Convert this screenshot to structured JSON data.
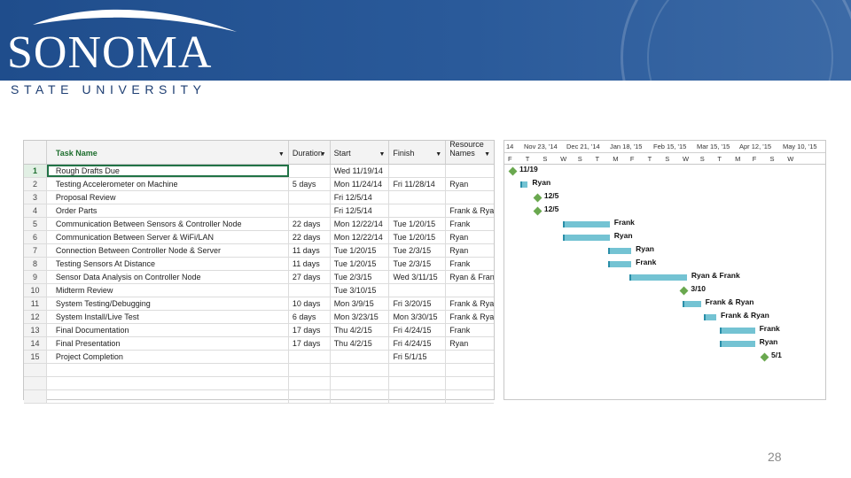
{
  "brand": {
    "name": "SONOMA",
    "subtitle": "STATE UNIVERSITY"
  },
  "page_number": "28",
  "table": {
    "headers": {
      "name": "Task Name",
      "duration": "Duration",
      "start": "Start",
      "finish": "Finish",
      "resources": "Resource Names"
    },
    "rows": [
      {
        "id": "1",
        "name": "Rough Drafts Due",
        "duration": "",
        "start": "Wed 11/19/14",
        "finish": "",
        "resources": ""
      },
      {
        "id": "2",
        "name": "Testing Accelerometer on Machine",
        "duration": "5 days",
        "start": "Mon 11/24/14",
        "finish": "Fri 11/28/14",
        "resources": "Ryan"
      },
      {
        "id": "3",
        "name": "Proposal Review",
        "duration": "",
        "start": "Fri 12/5/14",
        "finish": "",
        "resources": ""
      },
      {
        "id": "4",
        "name": "Order Parts",
        "duration": "",
        "start": "Fri 12/5/14",
        "finish": "",
        "resources": "Frank & Ryan"
      },
      {
        "id": "5",
        "name": "Communication Between Sensors & Controller Node",
        "duration": "22 days",
        "start": "Mon 12/22/14",
        "finish": "Tue 1/20/15",
        "resources": "Frank"
      },
      {
        "id": "6",
        "name": "Communication Between Server & WiFi/LAN",
        "duration": "22 days",
        "start": "Mon 12/22/14",
        "finish": "Tue 1/20/15",
        "resources": "Ryan"
      },
      {
        "id": "7",
        "name": "Connection Between Controller Node & Server",
        "duration": "11 days",
        "start": "Tue 1/20/15",
        "finish": "Tue 2/3/15",
        "resources": "Ryan"
      },
      {
        "id": "8",
        "name": "Testing Sensors At Distance",
        "duration": "11 days",
        "start": "Tue 1/20/15",
        "finish": "Tue 2/3/15",
        "resources": "Frank"
      },
      {
        "id": "9",
        "name": "Sensor Data Analysis on Controller Node",
        "duration": "27 days",
        "start": "Tue 2/3/15",
        "finish": "Wed 3/11/15",
        "resources": "Ryan & Frank"
      },
      {
        "id": "10",
        "name": "Midterm Review",
        "duration": "",
        "start": "Tue 3/10/15",
        "finish": "",
        "resources": ""
      },
      {
        "id": "11",
        "name": "System Testing/Debugging",
        "duration": "10 days",
        "start": "Mon 3/9/15",
        "finish": "Fri 3/20/15",
        "resources": "Frank & Ryan"
      },
      {
        "id": "12",
        "name": "System Install/Live Test",
        "duration": "6 days",
        "start": "Mon 3/23/15",
        "finish": "Mon 3/30/15",
        "resources": "Frank & Ryan"
      },
      {
        "id": "13",
        "name": "Final Documentation",
        "duration": "17 days",
        "start": "Thu 4/2/15",
        "finish": "Fri 4/24/15",
        "resources": "Frank"
      },
      {
        "id": "14",
        "name": "Final Presentation",
        "duration": "17 days",
        "start": "Thu 4/2/15",
        "finish": "Fri 4/24/15",
        "resources": "Ryan"
      },
      {
        "id": "15",
        "name": "Project Completion",
        "duration": "",
        "start": "",
        "finish": "Fri 5/1/15",
        "resources": ""
      }
    ]
  },
  "gantt": {
    "weeks": [
      "14",
      "Nov 23, '14",
      "Dec 21, '14",
      "Jan 18, '15",
      "Feb 15, '15",
      "Mar 15, '15",
      "Apr 12, '15",
      "May 10, '15"
    ],
    "days": [
      "F",
      "T",
      "S",
      "W",
      "S",
      "T",
      "M",
      "F",
      "T",
      "S",
      "W",
      "S",
      "T",
      "M",
      "F",
      "S",
      "W"
    ],
    "items": [
      {
        "type": "milestone",
        "label": "11/19",
        "start": "2014-11-19"
      },
      {
        "type": "bar",
        "label": "Ryan",
        "start": "2014-11-24",
        "finish": "2014-11-28"
      },
      {
        "type": "milestone",
        "label": "12/5",
        "start": "2014-12-05"
      },
      {
        "type": "milestone",
        "label": "12/5",
        "start": "2014-12-05"
      },
      {
        "type": "bar",
        "label": "Frank",
        "start": "2014-12-22",
        "finish": "2015-01-20"
      },
      {
        "type": "bar",
        "label": "Ryan",
        "start": "2014-12-22",
        "finish": "2015-01-20"
      },
      {
        "type": "bar",
        "label": "Ryan",
        "start": "2015-01-20",
        "finish": "2015-02-03"
      },
      {
        "type": "bar",
        "label": "Frank",
        "start": "2015-01-20",
        "finish": "2015-02-03"
      },
      {
        "type": "bar",
        "label": "Ryan & Frank",
        "start": "2015-02-03",
        "finish": "2015-03-11"
      },
      {
        "type": "milestone",
        "label": "3/10",
        "start": "2015-03-10"
      },
      {
        "type": "bar",
        "label": "Frank & Ryan",
        "start": "2015-03-09",
        "finish": "2015-03-20"
      },
      {
        "type": "bar",
        "label": "Frank & Ryan",
        "start": "2015-03-23",
        "finish": "2015-03-30"
      },
      {
        "type": "bar",
        "label": "Frank",
        "start": "2015-04-02",
        "finish": "2015-04-24"
      },
      {
        "type": "bar",
        "label": "Ryan",
        "start": "2015-04-02",
        "finish": "2015-04-24"
      },
      {
        "type": "milestone",
        "label": "5/1",
        "start": "2015-05-01"
      }
    ]
  }
}
